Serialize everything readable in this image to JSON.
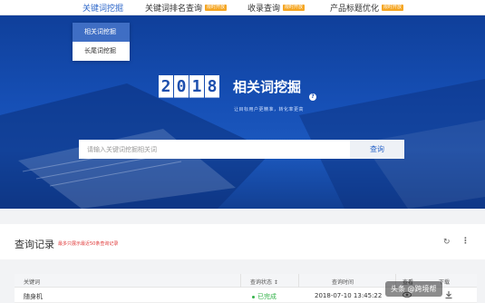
{
  "nav": {
    "items": [
      {
        "label": "关键词挖掘",
        "badge": ""
      },
      {
        "label": "关键词排名查询",
        "badge": "限时开放"
      },
      {
        "label": "收录查询",
        "badge": "限时开放"
      },
      {
        "label": "产品标题优化",
        "badge": "限时开放"
      }
    ]
  },
  "dropdown": {
    "items": [
      {
        "label": "相关词挖掘"
      },
      {
        "label": "长尾词挖掘"
      }
    ]
  },
  "hero": {
    "year_digits": [
      "2",
      "0",
      "1",
      "8"
    ],
    "title": "相关词挖掘",
    "help": "?",
    "subtitle": "让目标用户更精准，转化率更高"
  },
  "search": {
    "placeholder": "请输入关键词挖掘相关词",
    "button_label": "查询"
  },
  "records": {
    "title": "查询记录",
    "hint": "最多只展示最近50条查询记录",
    "refresh_icon": "↻",
    "more_icon": "⋮",
    "headers": {
      "keyword": "关键词",
      "status": "查询状态 ↕",
      "time": "查询时间",
      "view": "查看",
      "download": "下载"
    },
    "rows": [
      {
        "keyword": "随身机",
        "status": "已完成",
        "time": "2018-07-10 13:45:22"
      }
    ]
  },
  "watermark": "头条 @跨境帮"
}
